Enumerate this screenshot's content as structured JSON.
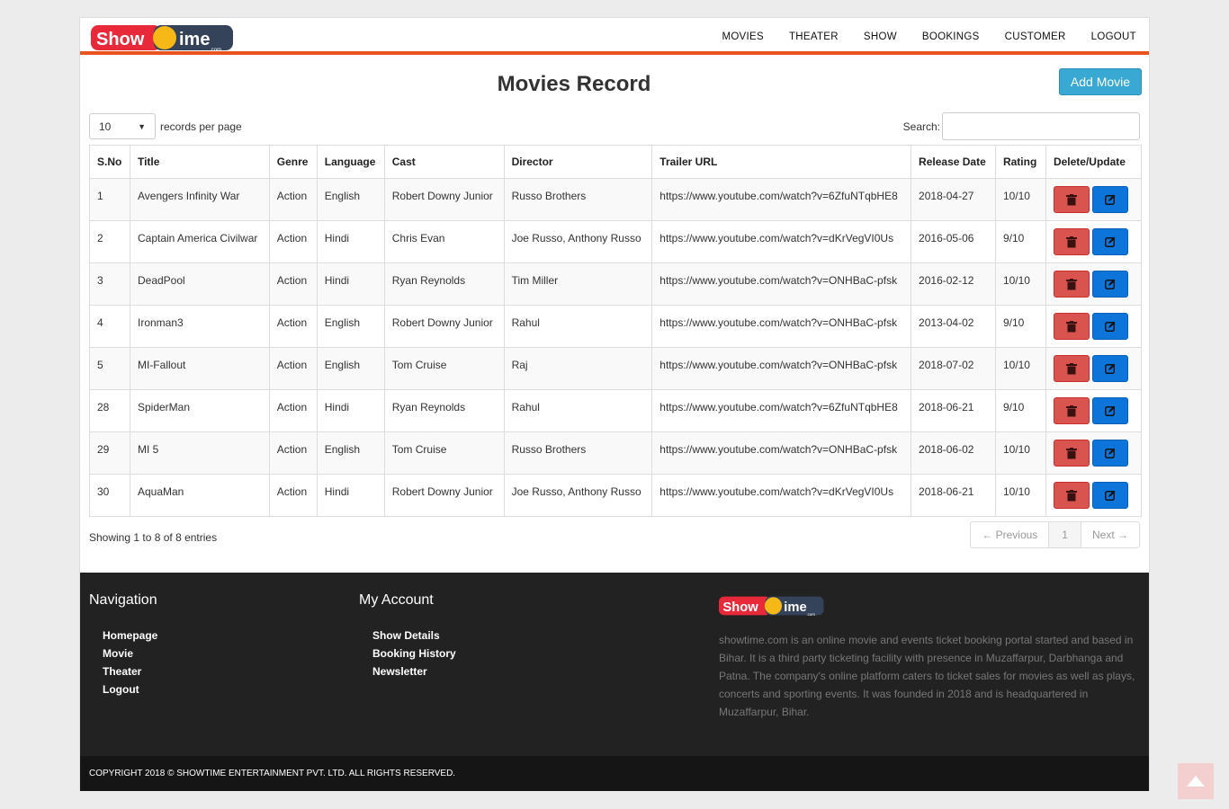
{
  "brand": {
    "logo_text_a": "Show",
    "logo_text_b": "ime",
    "logo_sub": ".com"
  },
  "nav": [
    "MOVIES",
    "THEATER",
    "SHOW",
    "BOOKINGS",
    "CUSTOMER",
    "LOGOUT"
  ],
  "page_title": "Movies Record",
  "add_button": "Add Movie",
  "length_menu": {
    "value": "10",
    "suffix": "records per page"
  },
  "search": {
    "label": "Search:",
    "value": ""
  },
  "table": {
    "headers": [
      "S.No",
      "Title",
      "Genre",
      "Language",
      "Cast",
      "Director",
      "Trailer URL",
      "Release Date",
      "Rating",
      "Delete/Update"
    ],
    "rows": [
      [
        "1",
        "Avengers Infinity War",
        "Action",
        "English",
        "Robert Downy Junior",
        "Russo Brothers",
        "https://www.youtube.com/watch?v=6ZfuNTqbHE8",
        "2018-04-27",
        "10/10"
      ],
      [
        "2",
        "Captain America Civilwar",
        "Action",
        "Hindi",
        "Chris Evan",
        "Joe Russo, Anthony Russo",
        "https://www.youtube.com/watch?v=dKrVegVI0Us",
        "2016-05-06",
        "9/10"
      ],
      [
        "3",
        "DeadPool",
        "Action",
        "Hindi",
        "Ryan Reynolds",
        "Tim Miller",
        "https://www.youtube.com/watch?v=ONHBaC-pfsk",
        "2016-02-12",
        "10/10"
      ],
      [
        "4",
        "Ironman3",
        "Action",
        "English",
        "Robert Downy Junior",
        "Rahul",
        "https://www.youtube.com/watch?v=ONHBaC-pfsk",
        "2013-04-02",
        "9/10"
      ],
      [
        "5",
        "MI-Fallout",
        "Action",
        "English",
        "Tom Cruise",
        "Raj",
        "https://www.youtube.com/watch?v=ONHBaC-pfsk",
        "2018-07-02",
        "10/10"
      ],
      [
        "28",
        "SpiderMan",
        "Action",
        "Hindi",
        "Ryan Reynolds",
        "Rahul",
        "https://www.youtube.com/watch?v=6ZfuNTqbHE8",
        "2018-06-21",
        "9/10"
      ],
      [
        "29",
        "MI 5",
        "Action",
        "English",
        "Tom Cruise",
        "Russo Brothers",
        "https://www.youtube.com/watch?v=ONHBaC-pfsk",
        "2018-06-02",
        "10/10"
      ],
      [
        "30",
        "AquaMan",
        "Action",
        "Hindi",
        "Robert Downy Junior",
        "Joe Russo, Anthony Russo",
        "https://www.youtube.com/watch?v=dKrVegVI0Us",
        "2018-06-21",
        "10/10"
      ]
    ]
  },
  "table_info": "Showing 1 to 8 of 8 entries",
  "pagination": {
    "prev": "← Previous",
    "current": "1",
    "next": "Next →"
  },
  "footer": {
    "nav_title": "Navigation",
    "nav_links": [
      "Homepage",
      "Movie",
      "Theater",
      "Logout"
    ],
    "account_title": "My Account",
    "account_links": [
      "Show Details",
      "Booking History",
      "Newsletter"
    ],
    "about": "showtime.com is an online movie and events ticket booking portal started and based in Bihar. It is a third party ticketing facility with presence in Muzaffarpur, Darbhanga and Patna. The company's online platform caters to ticket sales for movies as well as plays, concerts and sporting events. It was founded in 2018 and is headquartered in Muzaffarpur, Bihar.",
    "copyright": "COPYRIGHT 2018 © SHOWTIME ENTERTAINMENT PVT. LTD. ALL RIGHTS RESERVED."
  },
  "colors": {
    "accent": "#e8531f",
    "add_button": "#39a9d3",
    "delete": "#d9534f",
    "edit": "#0d74d9",
    "footer": "#222222"
  },
  "icons": [
    "trash-icon",
    "edit-icon",
    "arrow-up-icon"
  ]
}
